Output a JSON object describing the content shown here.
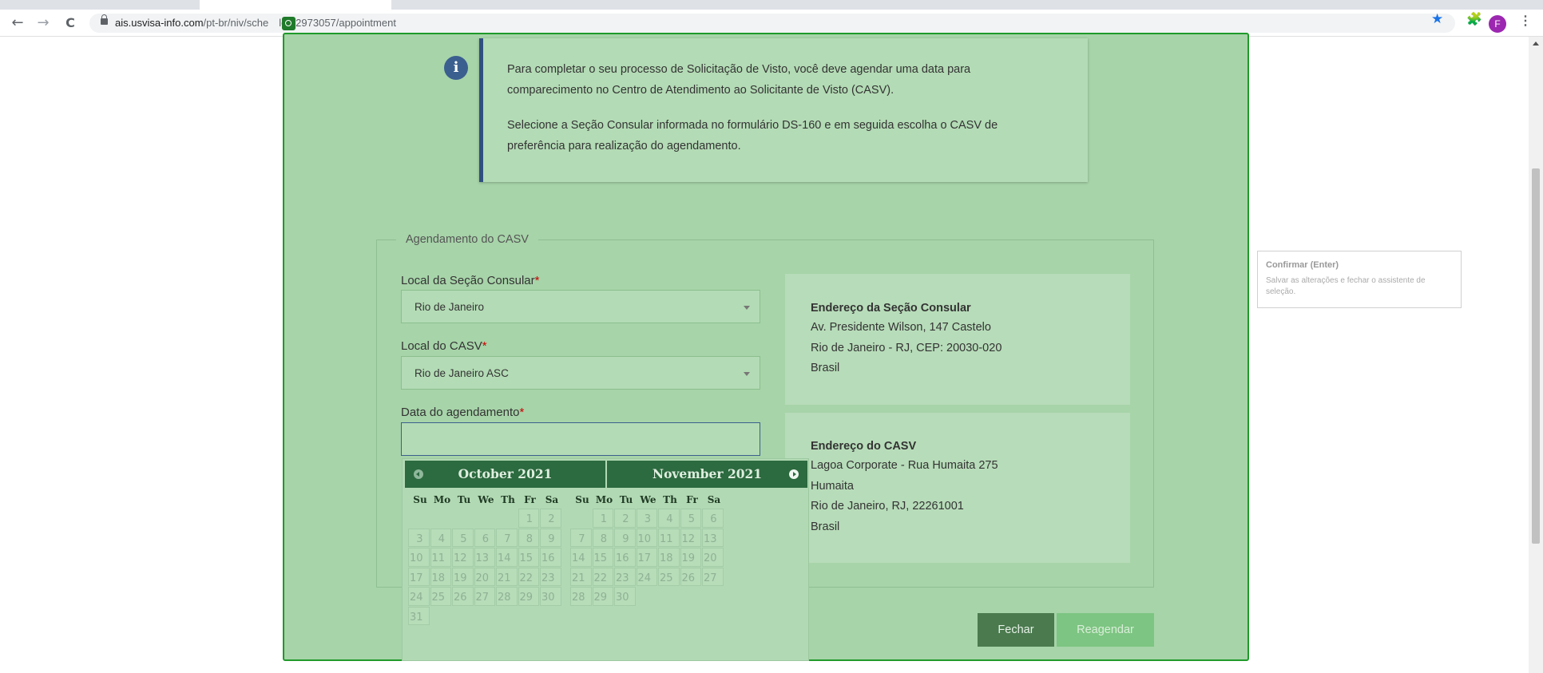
{
  "browser": {
    "url_domain": "ais.usvisa-info.com",
    "url_path": "/pt-br/niv/sche",
    "url_path_after": "le/32973057/appointment",
    "back": "←",
    "forward": "→",
    "reload": "C",
    "star": "★",
    "extensions": "🧩",
    "avatar_letter": "F",
    "menu": "⋮"
  },
  "info": {
    "icon": "i",
    "p1": "Para completar o seu processo de Solicitação de Visto, você deve agendar uma data para comparecimento no Centro de Atendimento ao Solicitante de Visto (CASV).",
    "p2": "Selecione a Seção Consular informada no formulário DS-160 e em seguida escolha o CASV de preferência para realização do agendamento."
  },
  "form": {
    "legend": "Agendamento do CASV",
    "consular_label": "Local da Seção Consular",
    "consular_value": "Rio de Janeiro",
    "casv_label": "Local do CASV",
    "casv_value": "Rio de Janeiro ASC",
    "date_label": "Data do agendamento",
    "required_mark": "*",
    "date_value": ""
  },
  "consular_address": {
    "title": "Endereço da Seção Consular",
    "line1": "Av. Presidente Wilson, 147 Castelo",
    "line2": "Rio de Janeiro - RJ, CEP: 20030-020",
    "line3": "Brasil"
  },
  "casv_address": {
    "title": "Endereço do CASV",
    "line1": "Lagoa Corporate - Rua Humaita 275",
    "line2": "Humaita",
    "line3": "Rio de Janeiro, RJ, 22261001",
    "line4": "Brasil"
  },
  "buttons": {
    "close": "Fechar",
    "reschedule": "Reagendar"
  },
  "side_panel": {
    "title": "Confirmar (Enter)",
    "description": "Salvar as alterações e fechar o assistente de seleção."
  },
  "datepicker": {
    "weekdays": [
      "Su",
      "Mo",
      "Tu",
      "We",
      "Th",
      "Fr",
      "Sa"
    ],
    "months": [
      {
        "title": "October 2021",
        "first_weekday": 5,
        "days": 31
      },
      {
        "title": "November 2021",
        "first_weekday": 1,
        "days": 30
      }
    ]
  }
}
